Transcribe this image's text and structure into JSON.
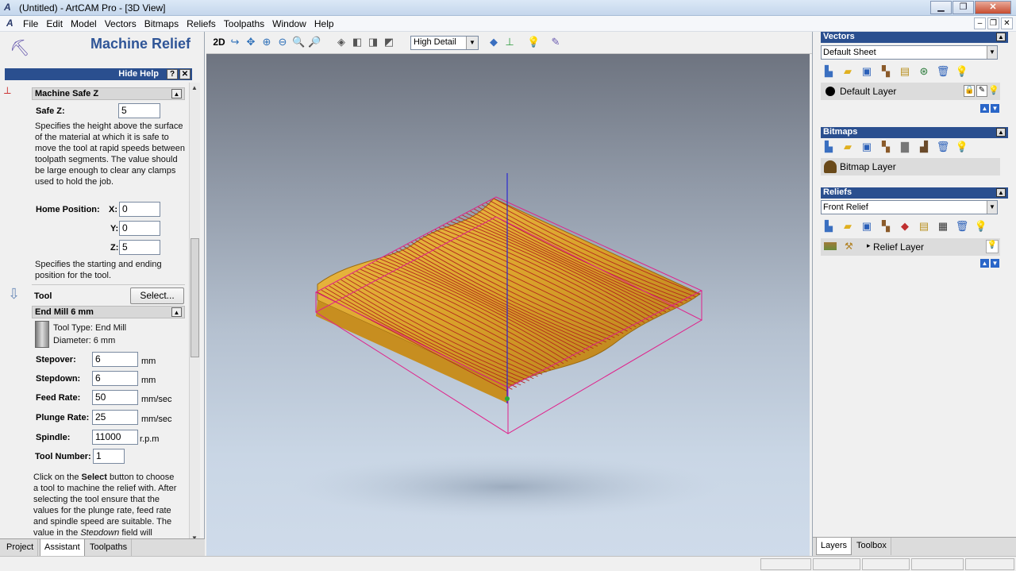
{
  "window": {
    "title": "(Untitled) - ArtCAM Pro - [3D View]"
  },
  "menu": [
    "File",
    "Edit",
    "Model",
    "Vectors",
    "Bitmaps",
    "Reliefs",
    "Toolpaths",
    "Window",
    "Help"
  ],
  "left": {
    "title": "Machine Relief",
    "hide_help": "Hide Help",
    "safe_section": "Machine Safe Z",
    "safe_z_label": "Safe Z:",
    "safe_z": "5",
    "safe_help": "Specifies the height above the surface of the material at which it is safe to move the tool at rapid speeds between toolpath segments. The value should be large enough to clear any clamps used to hold the job.",
    "home_label": "Home Position:",
    "x_label": "X:",
    "x": "0",
    "y_label": "Y:",
    "y": "0",
    "z_label": "Z:",
    "z": "5",
    "home_help": "Specifies the starting and ending position for the tool.",
    "tool_label": "Tool",
    "select_label": "Select...",
    "tool_name": "End Mill 6 mm",
    "tool_type": "Tool Type: End Mill",
    "diameter": "Diameter: 6 mm",
    "stepover_label": "Stepover:",
    "stepover": "6",
    "stepover_unit": "mm",
    "stepdown_label": "Stepdown:",
    "stepdown": "6",
    "stepdown_unit": "mm",
    "feed_label": "Feed Rate:",
    "feed": "50",
    "feed_unit": "mm/sec",
    "plunge_label": "Plunge Rate:",
    "plunge": "25",
    "plunge_unit": "mm/sec",
    "spindle_label": "Spindle:",
    "spindle": "11000",
    "spindle_unit": "r.p.m",
    "toolnum_label": "Tool Number:",
    "toolnum": "1",
    "help_line1_pre": "Click on the ",
    "help_line1_bold": "Select",
    "help_line1_post": " button to choose",
    "help_line2": "a tool to machine the relief with. After",
    "help_line3": "selecting the tool ensure that the",
    "help_line4": "values for the plunge rate, feed rate",
    "help_line5": "and spindle speed are suitable. The",
    "help_line6_pre": "value in the ",
    "help_line6_ital": "Stepdown",
    "help_line6_post": " field will",
    "tabs": [
      "Project",
      "Assistant",
      "Toolpaths"
    ]
  },
  "toolbar": {
    "mode": "2D",
    "detail": "High Detail"
  },
  "right": {
    "vectors": {
      "title": "Vectors",
      "sheet": "Default Sheet",
      "layer": "Default Layer"
    },
    "bitmaps": {
      "title": "Bitmaps",
      "layer": "Bitmap Layer"
    },
    "reliefs": {
      "title": "Reliefs",
      "sheet": "Front Relief",
      "layer": "Relief Layer"
    },
    "tabs": [
      "Layers",
      "Toolbox"
    ]
  }
}
